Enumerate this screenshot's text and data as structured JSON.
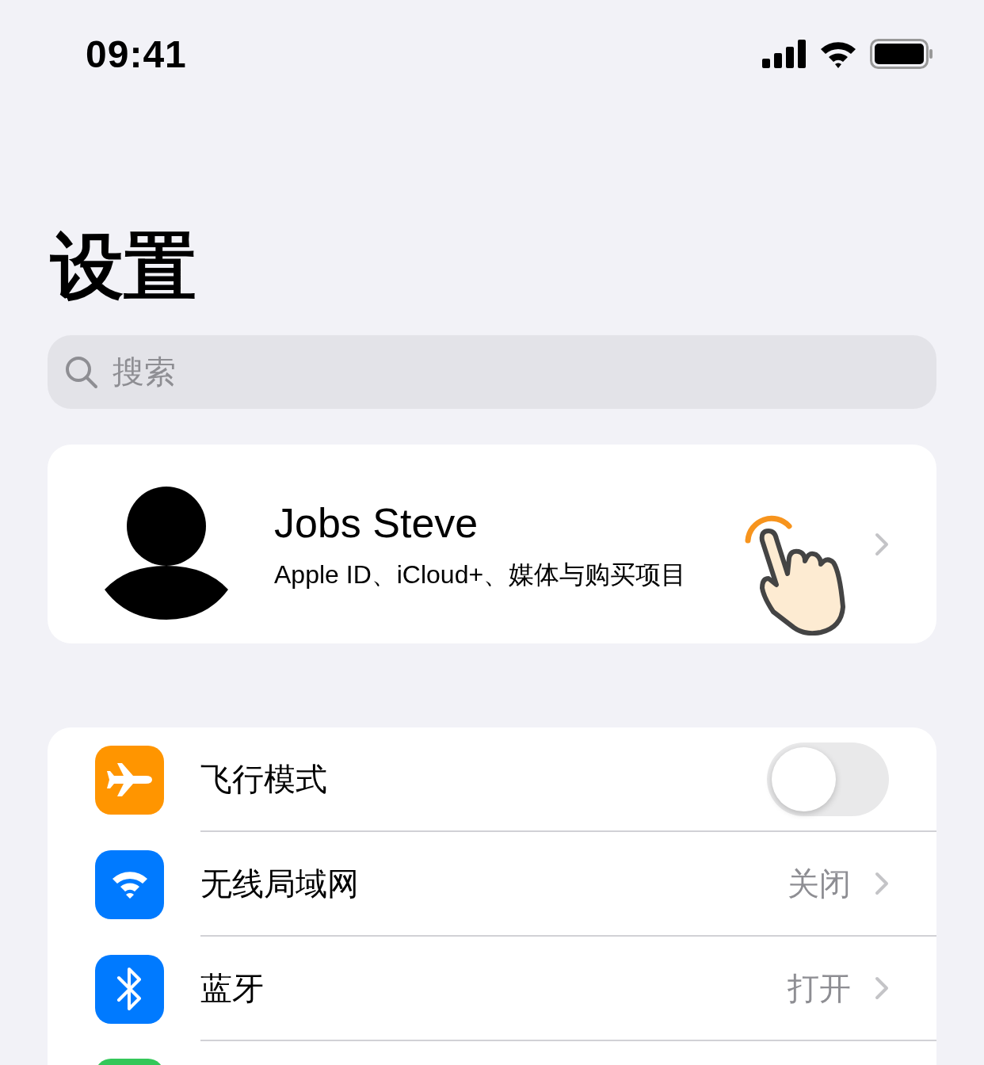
{
  "status_bar": {
    "time": "09:41"
  },
  "title": "设置",
  "search": {
    "placeholder": "搜索"
  },
  "profile": {
    "name": "Jobs Steve",
    "subtitle": "Apple ID、iCloud+、媒体与购买项目"
  },
  "settings": [
    {
      "kind": "toggle",
      "label": "飞行模式",
      "on": false,
      "color": "#ff9500"
    },
    {
      "kind": "link",
      "label": "无线局域网",
      "value": "关闭",
      "color": "#007aff"
    },
    {
      "kind": "link",
      "label": "蓝牙",
      "value": "打开",
      "color": "#007aff"
    },
    {
      "kind": "partial",
      "color": "#34c759"
    }
  ]
}
